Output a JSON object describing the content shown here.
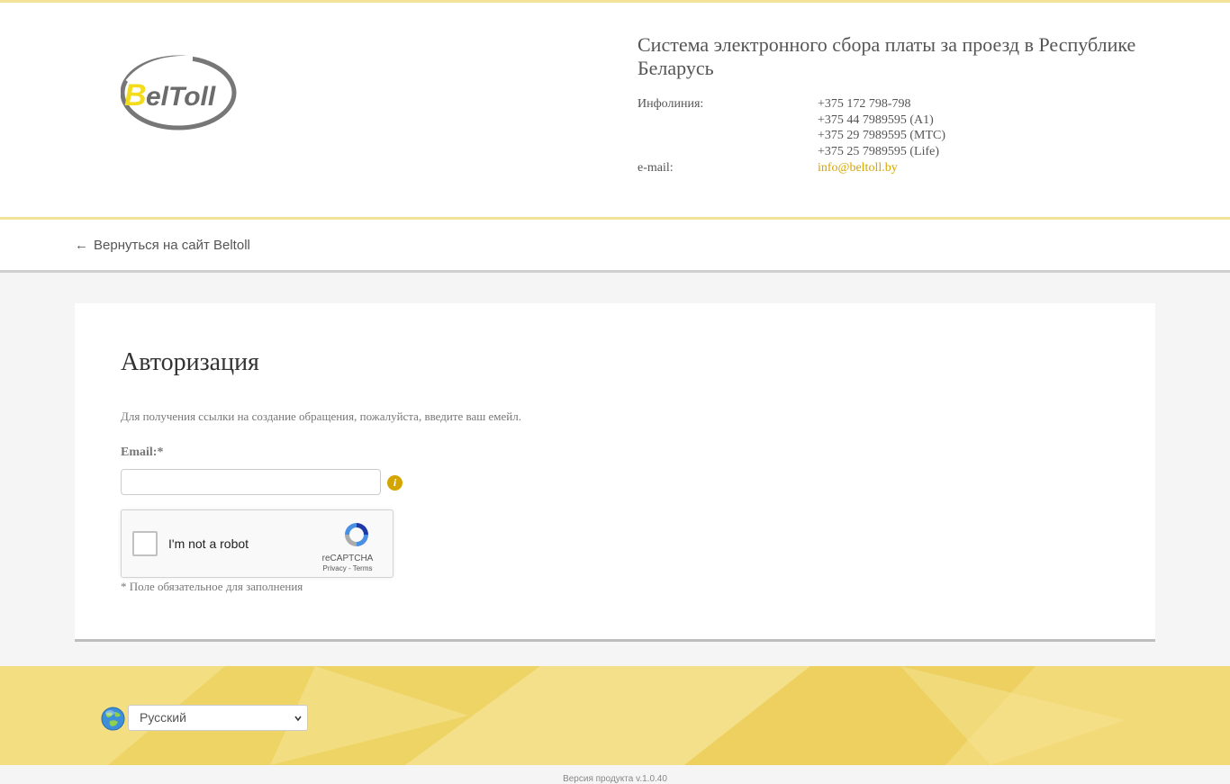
{
  "header": {
    "logo_text_a": "B",
    "logo_text_b": "elToll",
    "title": "Система электронного сбора платы за проезд в Республике Беларусь",
    "infoline_label": "Инфолиния:",
    "phones": [
      "+375 172 798-798",
      "+375 44 7989595 (A1)",
      "+375 29 7989595 (МТС)",
      "+375 25 7989595 (Life)"
    ],
    "email_label": "e-mail:",
    "email": "info@beltoll.by"
  },
  "nav": {
    "back_arrow": "←",
    "back_label": "Вернуться на сайт Beltoll"
  },
  "form": {
    "title": "Авторизация",
    "intro": "Для получения ссылки на создание обращения, пожалуйста, введите ваш емейл.",
    "email_label": "Email:*",
    "email_value": "",
    "info_icon_glyph": "i",
    "required_note": "* Поле обязательное для заполнения"
  },
  "recaptcha": {
    "label": "I'm not a robot",
    "brand": "reCAPTCHA",
    "links": "Privacy - Terms"
  },
  "footer": {
    "language_selected": "Русский",
    "version": "Версия продукта v.1.0.40"
  },
  "colors": {
    "accent": "#d4a500",
    "footer_bg": "#f0d870",
    "separator": "#f3e29a"
  }
}
